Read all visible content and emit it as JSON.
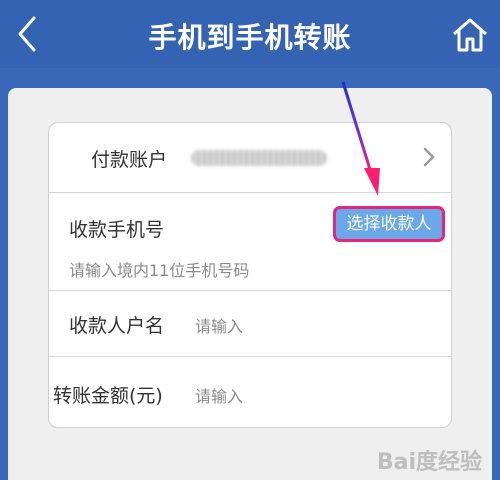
{
  "header": {
    "title": "手机到手机转账"
  },
  "form": {
    "account": {
      "label": "付款账户"
    },
    "phone": {
      "label": "收款手机号",
      "placeholder": "请输入境内11位手机号码",
      "select_button": "选择收款人"
    },
    "name": {
      "label": "收款人户名",
      "placeholder": "请输入"
    },
    "amount": {
      "label": "转账金额(元)",
      "placeholder": "请输入"
    }
  },
  "watermark": "Bai度经验",
  "colors": {
    "header_bg": "#3563b4",
    "button_bg": "#6aa8ea",
    "highlight": "#e8257a"
  },
  "icons": {
    "back": "chevron-left-icon",
    "home": "home-icon",
    "row_arrow": "chevron-right-icon"
  }
}
